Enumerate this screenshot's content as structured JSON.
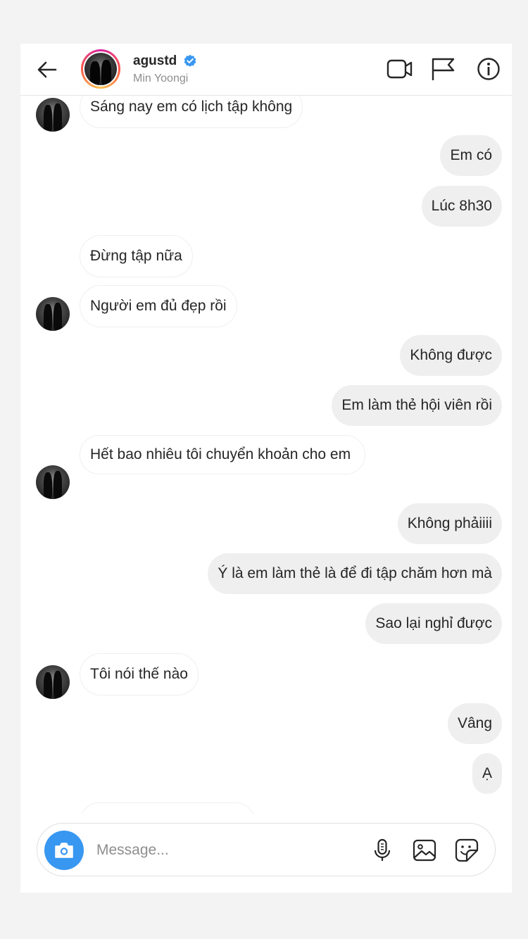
{
  "header": {
    "username": "agustd",
    "subtitle": "Min Yoongi"
  },
  "messages": [
    {
      "from": "them",
      "text": "Sáng nay em có lịch tập không"
    },
    {
      "from": "me",
      "text": "Em có"
    },
    {
      "from": "me",
      "text": "Lúc 8h30"
    },
    {
      "from": "them",
      "text": "Đừng tập nữa"
    },
    {
      "from": "them",
      "text": "Người em đủ đẹp rồi"
    },
    {
      "from": "me",
      "text": "Không được"
    },
    {
      "from": "me",
      "text": "Em làm thẻ hội viên rồi"
    },
    {
      "from": "them",
      "text": "Hết bao nhiêu tôi chuyển khoản cho em"
    },
    {
      "from": "me",
      "text": "Không phảiiii"
    },
    {
      "from": "me",
      "text": "Ý là em làm thẻ là để đi tập chăm hơn mà"
    },
    {
      "from": "me",
      "text": "Sao lại nghỉ được"
    },
    {
      "from": "them",
      "text": "Tôi nói thế nào"
    },
    {
      "from": "me",
      "text": "Vâng"
    },
    {
      "from": "me",
      "text": "Ạ"
    }
  ],
  "composer": {
    "placeholder": "Message..."
  },
  "colors": {
    "accent": "#3897f0",
    "verified": "#3897f0",
    "bubble_out": "#efefef",
    "muted_text": "#8e8e8e"
  },
  "icons": [
    "back-arrow-icon",
    "verified-badge-icon",
    "video-call-icon",
    "flag-icon",
    "info-icon",
    "camera-icon",
    "microphone-icon",
    "gallery-icon",
    "sticker-icon"
  ]
}
